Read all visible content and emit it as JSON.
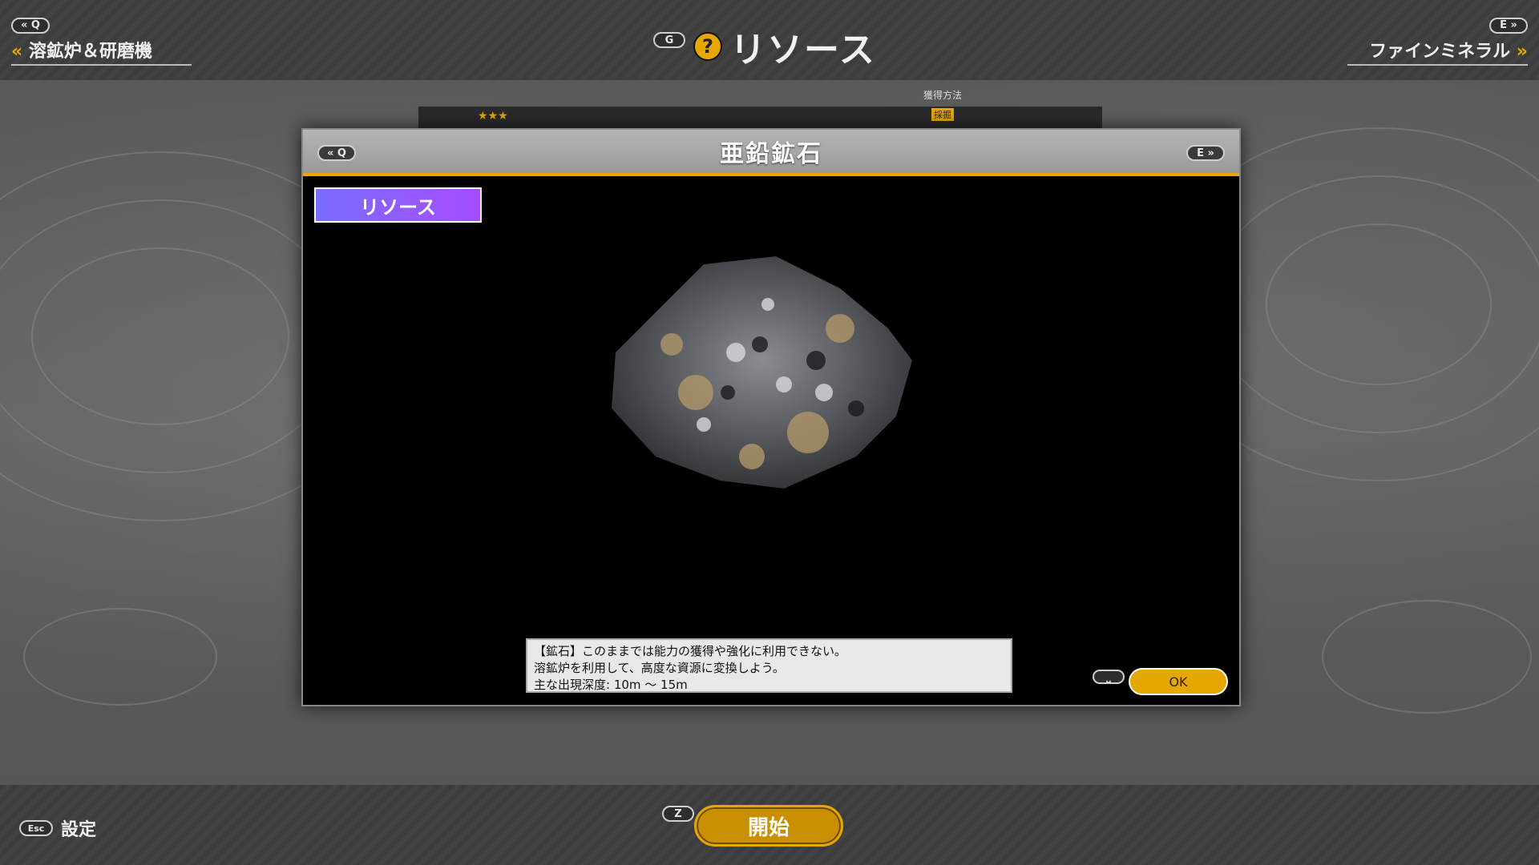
{
  "header": {
    "left_key": "« Q",
    "left_label": "溶鉱炉＆研磨機",
    "help_key": "G",
    "help_icon": "question-icon",
    "title": "リソース",
    "right_key": "E »",
    "right_label": "ファインミネラル"
  },
  "underlay": {
    "column_header": "獲得方法",
    "stars": "★★★",
    "badge": "採掘"
  },
  "modal": {
    "prev_key": "« Q",
    "next_key": "E »",
    "title": "亜鉛鉱石",
    "category_tag": "リソース",
    "description_lines": [
      "【鉱石】このままでは能力の獲得や強化に利用できない。",
      "溶鉱炉を利用して、高度な資源に変換しよう。",
      "主な出現深度: 10m 〜 15m"
    ],
    "confirm_key": "⎵",
    "ok_label": "OK"
  },
  "footer": {
    "esc_key": "Esc",
    "settings_label": "設定",
    "start_key": "Z",
    "start_label": "開始"
  },
  "colors": {
    "accent": "#e6a800",
    "tag_start": "#7b6cff",
    "tag_end": "#a64dff"
  }
}
